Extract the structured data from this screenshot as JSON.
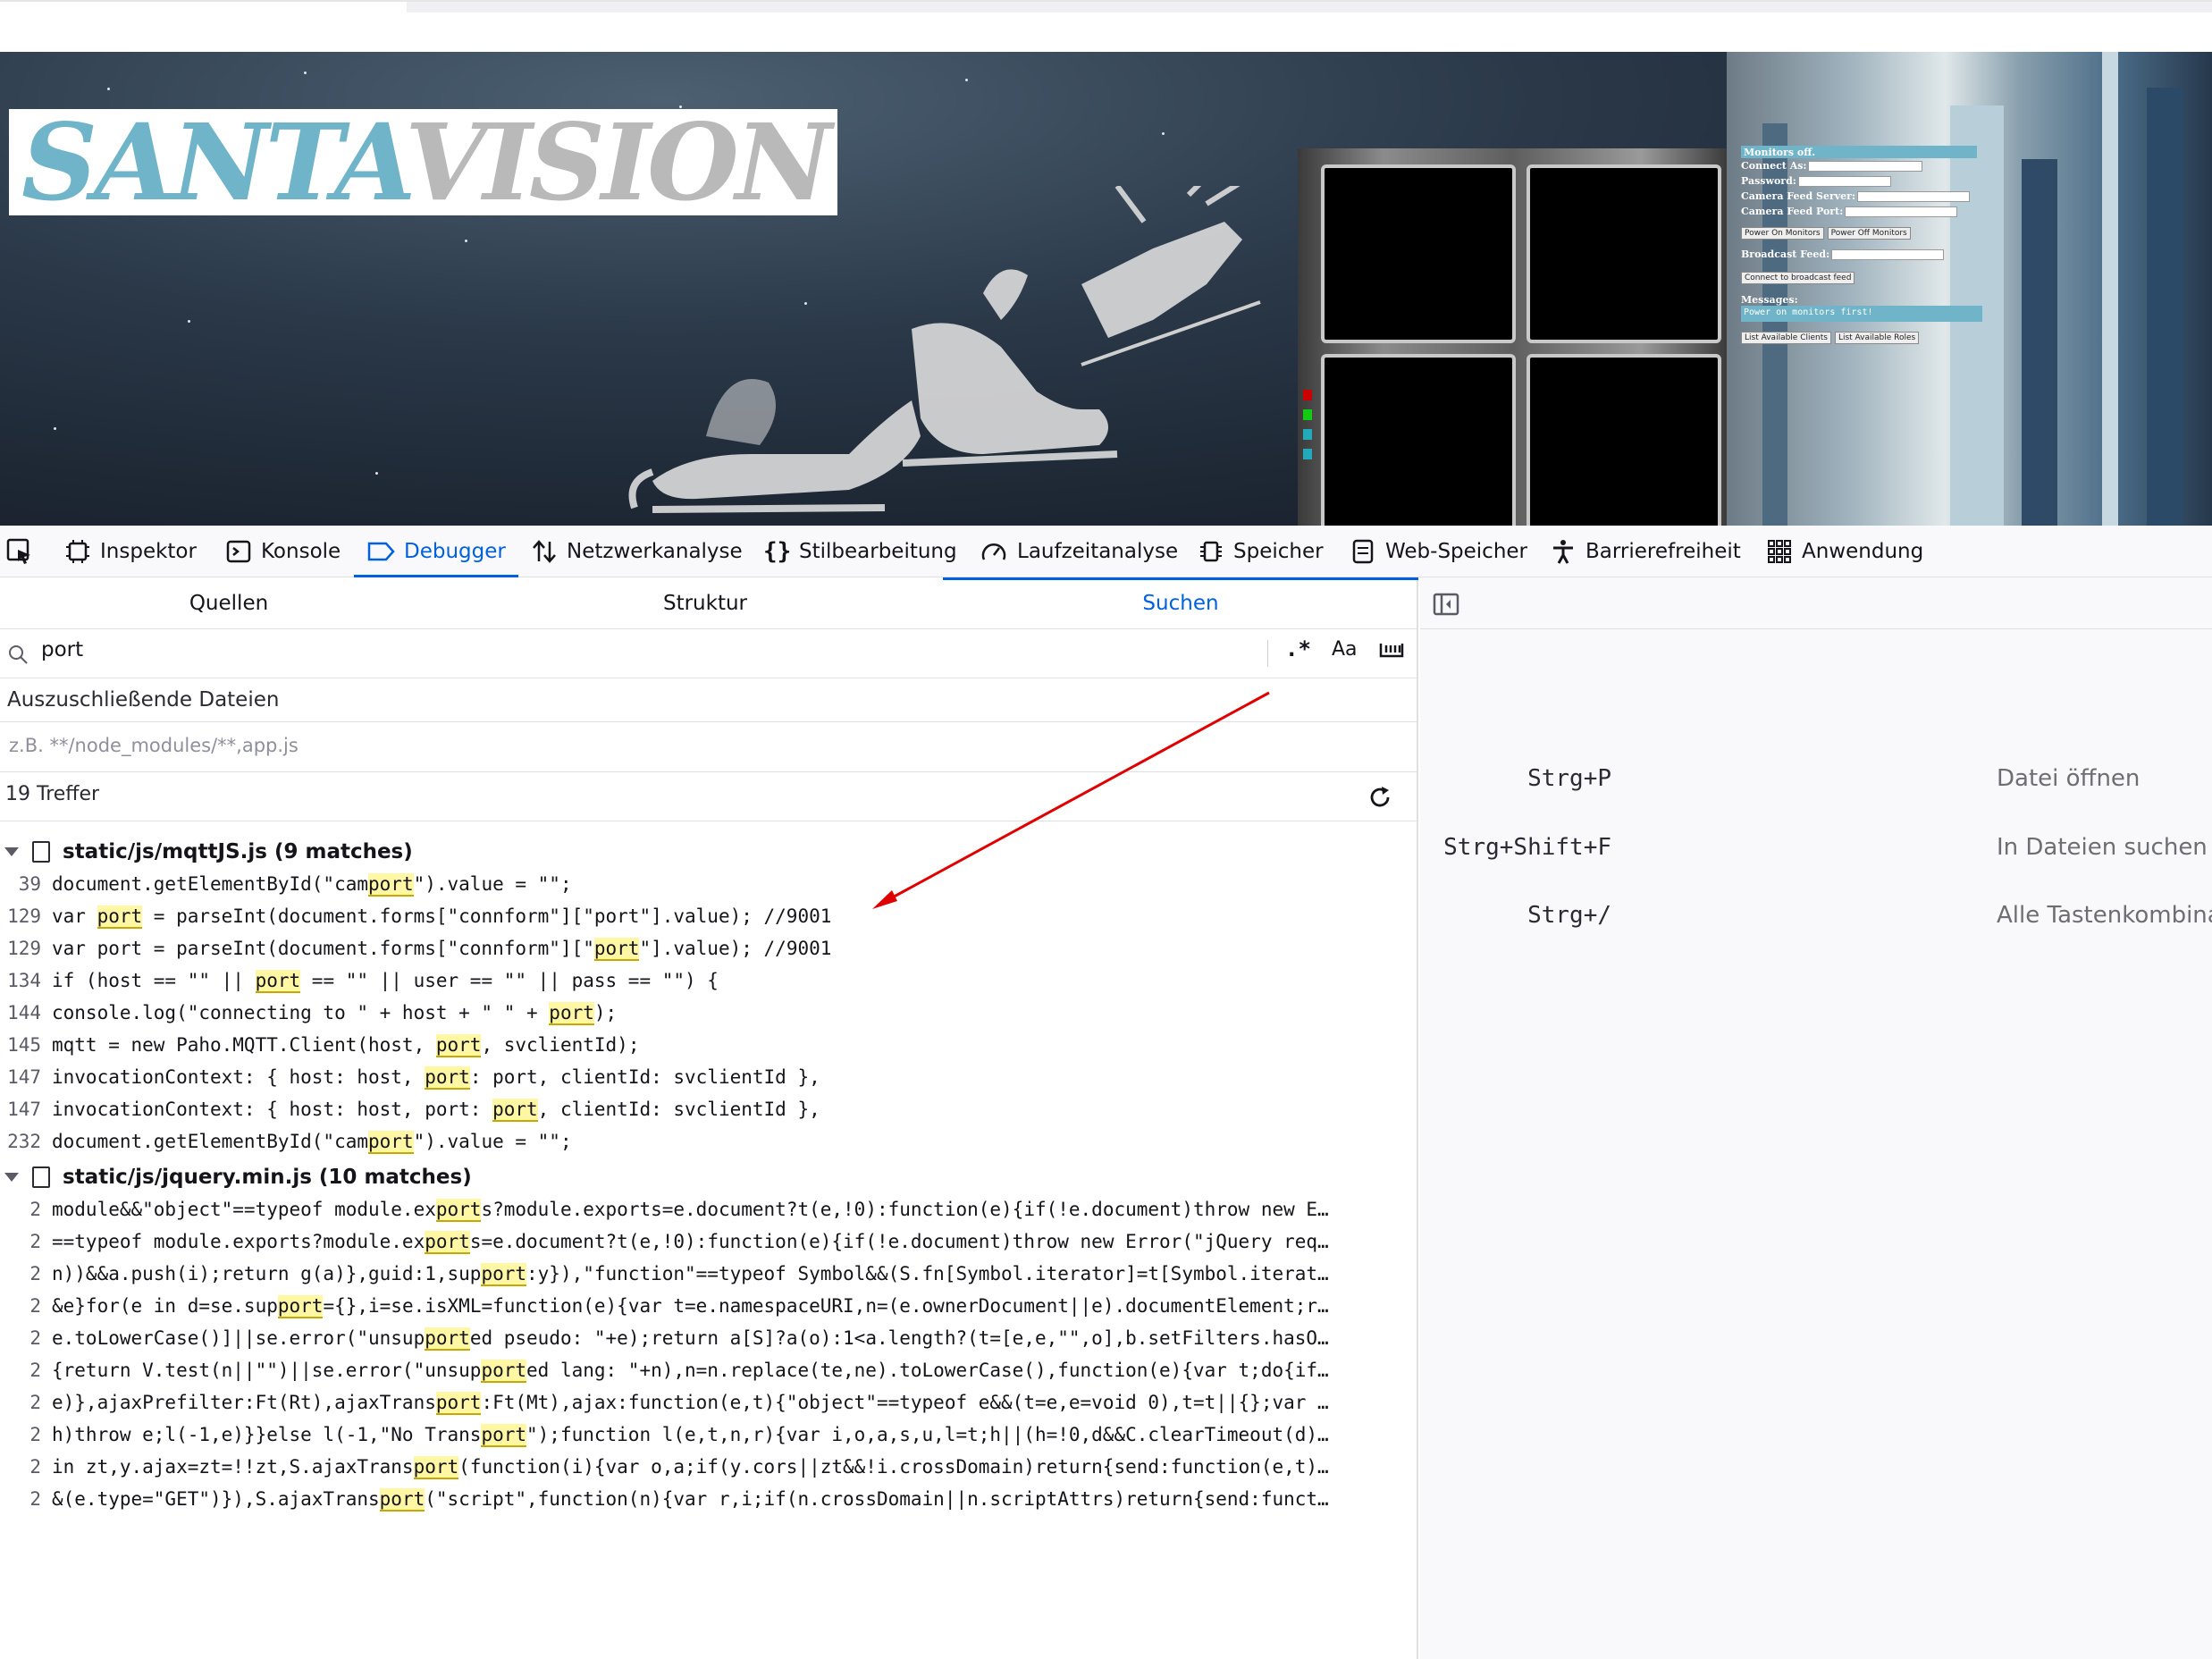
{
  "page": {
    "logo_part1": "SANTA",
    "logo_part2": "VISION",
    "panel": {
      "status_bar": "Monitors off.",
      "connect_as_label": "Connect As:",
      "password_label": "Password:",
      "camera_server_label": "Camera Feed Server:",
      "camera_port_label": "Camera Feed Port:",
      "power_on_button": "Power On Monitors",
      "power_off_button": "Power Off Monitors",
      "broadcast_label": "Broadcast Feed:",
      "connect_broadcast_button": "Connect to broadcast feed",
      "messages_label": "Messages:",
      "messages_value": "Power on monitors first!",
      "list_clients_button": "List Available Clients",
      "list_roles_button": "List Available Roles"
    }
  },
  "devtools": {
    "tabs": {
      "inspector": "Inspektor",
      "console": "Konsole",
      "debugger": "Debugger",
      "network": "Netzwerkanalyse",
      "style": "Stilbearbeitung",
      "performance": "Laufzeitanalyse",
      "memory": "Speicher",
      "storage": "Web-Speicher",
      "accessibility": "Barrierefreiheit",
      "application": "Anwendung"
    },
    "sub_tabs": {
      "sources": "Quellen",
      "outline": "Struktur",
      "search": "Suchen"
    },
    "search": {
      "value": "port",
      "regex_toggle": ".*",
      "case_toggle": "Aa"
    },
    "exclude": {
      "label": "Auszuschließende Dateien",
      "placeholder": "z.B. **/node_modules/**,app.js"
    },
    "hits": "19 Treffer",
    "files": [
      {
        "name": "static/js/mqttJS.js (9 matches)",
        "lines": [
          {
            "ln": "39",
            "pre": "document.getElementById(\"cam",
            "match": "port",
            "post": "\").value = \"\";"
          },
          {
            "ln": "129",
            "pre": "var ",
            "match": "port",
            "post": " = parseInt(document.forms[\"connform\"][\"port\"].value); //9001"
          },
          {
            "ln": "129",
            "pre": "var port = parseInt(document.forms[\"connform\"][\"",
            "match": "port",
            "post": "\"].value); //9001"
          },
          {
            "ln": "134",
            "pre": "if (host == \"\" || ",
            "match": "port",
            "post": " == \"\" || user == \"\" || pass == \"\") {"
          },
          {
            "ln": "144",
            "pre": "console.log(\"connecting to \" + host + \" \" + ",
            "match": "port",
            "post": ");"
          },
          {
            "ln": "145",
            "pre": "mqtt = new Paho.MQTT.Client(host, ",
            "match": "port",
            "post": ", svclientId);"
          },
          {
            "ln": "147",
            "pre": "invocationContext: { host: host, ",
            "match": "port",
            "post": ": port, clientId: svclientId },"
          },
          {
            "ln": "147",
            "pre": "invocationContext: { host: host, port: ",
            "match": "port",
            "post": ", clientId: svclientId },"
          },
          {
            "ln": "232",
            "pre": "document.getElementById(\"cam",
            "match": "port",
            "post": "\").value = \"\";"
          }
        ]
      },
      {
        "name": "static/js/jquery.min.js (10 matches)",
        "lines": [
          {
            "ln": "2",
            "pre": "module&&\"object\"==typeof module.ex",
            "match": "port",
            "post": "s?module.exports=e.document?t(e,!0):function(e){if(!e.document)throw new E…"
          },
          {
            "ln": "2",
            "pre": "==typeof module.exports?module.ex",
            "match": "port",
            "post": "s=e.document?t(e,!0):function(e){if(!e.document)throw new Error(\"jQuery req…"
          },
          {
            "ln": "2",
            "pre": "n))&&a.push(i);return g(a)},guid:1,sup",
            "match": "port",
            "post": ":y}),\"function\"==typeof Symbol&&(S.fn[Symbol.iterator]=t[Symbol.iterat…"
          },
          {
            "ln": "2",
            "pre": "&e}for(e in d=se.sup",
            "match": "port",
            "post": "={},i=se.isXML=function(e){var t=e.namespaceURI,n=(e.ownerDocument||e).documentElement;r…"
          },
          {
            "ln": "2",
            "pre": "e.toLowerCase()]||se.error(\"unsup",
            "match": "port",
            "post": "ed pseudo: \"+e);return a[S]?a(o):1<a.length?(t=[e,e,\"\",o],b.setFilters.hasO…"
          },
          {
            "ln": "2",
            "pre": "{return V.test(n||\"\")||se.error(\"unsup",
            "match": "port",
            "post": "ed lang: \"+n),n=n.replace(te,ne).toLowerCase(),function(e){var t;do{if…"
          },
          {
            "ln": "2",
            "pre": "e)},ajaxPrefilter:Ft(Rt),ajaxTrans",
            "match": "port",
            "post": ":Ft(Mt),ajax:function(e,t){\"object\"==typeof e&&(t=e,e=void 0),t=t||{};var …"
          },
          {
            "ln": "2",
            "pre": "h)throw e;l(-1,e)}}else l(-1,\"No Trans",
            "match": "port",
            "post": "\");function l(e,t,n,r){var i,o,a,s,u,l=t;h||(h=!0,d&&C.clearTimeout(d)…"
          },
          {
            "ln": "2",
            "pre": "in zt,y.ajax=zt=!!zt,S.ajaxTrans",
            "match": "port",
            "post": "(function(i){var o,a;if(y.cors||zt&&!i.crossDomain)return{send:function(e,t)…"
          },
          {
            "ln": "2",
            "pre": "&(e.type=\"GET\")}),S.ajaxTrans",
            "match": "port",
            "post": "(\"script\",function(n){var r,i;if(n.crossDomain||n.scriptAttrs)return{send:funct…"
          }
        ]
      }
    ],
    "shortcuts": [
      {
        "key": "Strg+P",
        "desc": "Datei öffnen"
      },
      {
        "key": "Strg+Shift+F",
        "desc": "In Dateien suchen"
      },
      {
        "key": "Strg+/",
        "desc": "Alle Tastenkombina"
      }
    ]
  },
  "colors": {
    "accent": "#0061e0",
    "match_highlight": "#fff7a3",
    "annotation_arrow": "#e00000",
    "logo_blue": "#6fb4c8",
    "logo_gray": "#b9b9b9"
  }
}
